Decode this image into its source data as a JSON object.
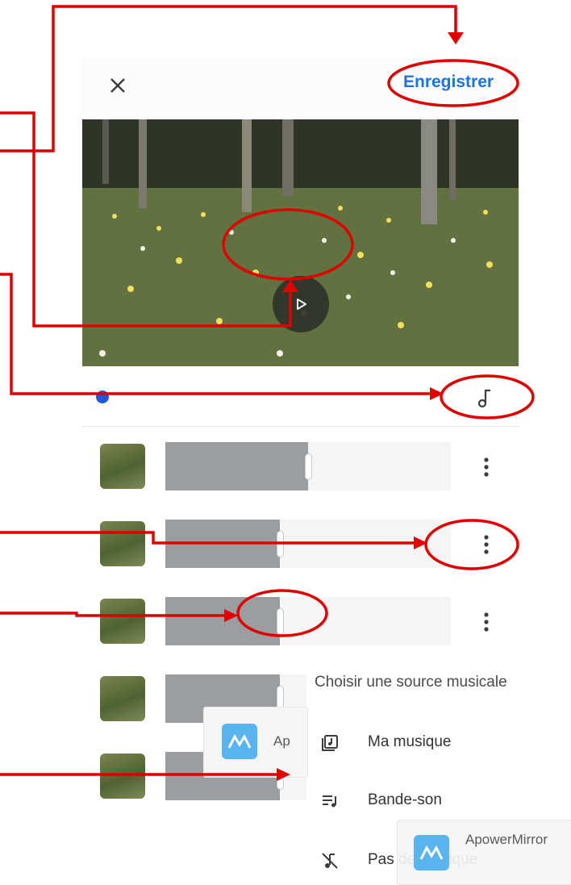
{
  "header": {
    "close_icon": "close-icon",
    "save_label": "Enregistrer",
    "accent_color": "#1a73e8"
  },
  "preview": {
    "play_icon": "play-icon"
  },
  "timeline": {
    "music_icon": "music-note-icon",
    "playhead_color": "#1a5ae0"
  },
  "clips": [
    {
      "trim_fraction": 0.5,
      "menu_icon": "more-vert-icon"
    },
    {
      "trim_fraction": 0.4,
      "menu_icon": "more-vert-icon"
    },
    {
      "trim_fraction": 0.4,
      "menu_icon": "more-vert-icon"
    },
    {
      "trim_fraction": 0.4
    },
    {
      "trim_fraction": 0.4
    }
  ],
  "music_sheet": {
    "title": "Choisir une source musicale",
    "items": [
      {
        "label": "Ma musique",
        "icon": "music-library-icon"
      },
      {
        "label": "Bande-son",
        "icon": "playlist-icon"
      },
      {
        "label": "Pas de musique",
        "icon": "music-off-icon"
      }
    ]
  },
  "overlays": {
    "apowermirror_partial": "Ap",
    "apowermirror_full": "ApowerMirror"
  },
  "annotation_color": "#e00000"
}
